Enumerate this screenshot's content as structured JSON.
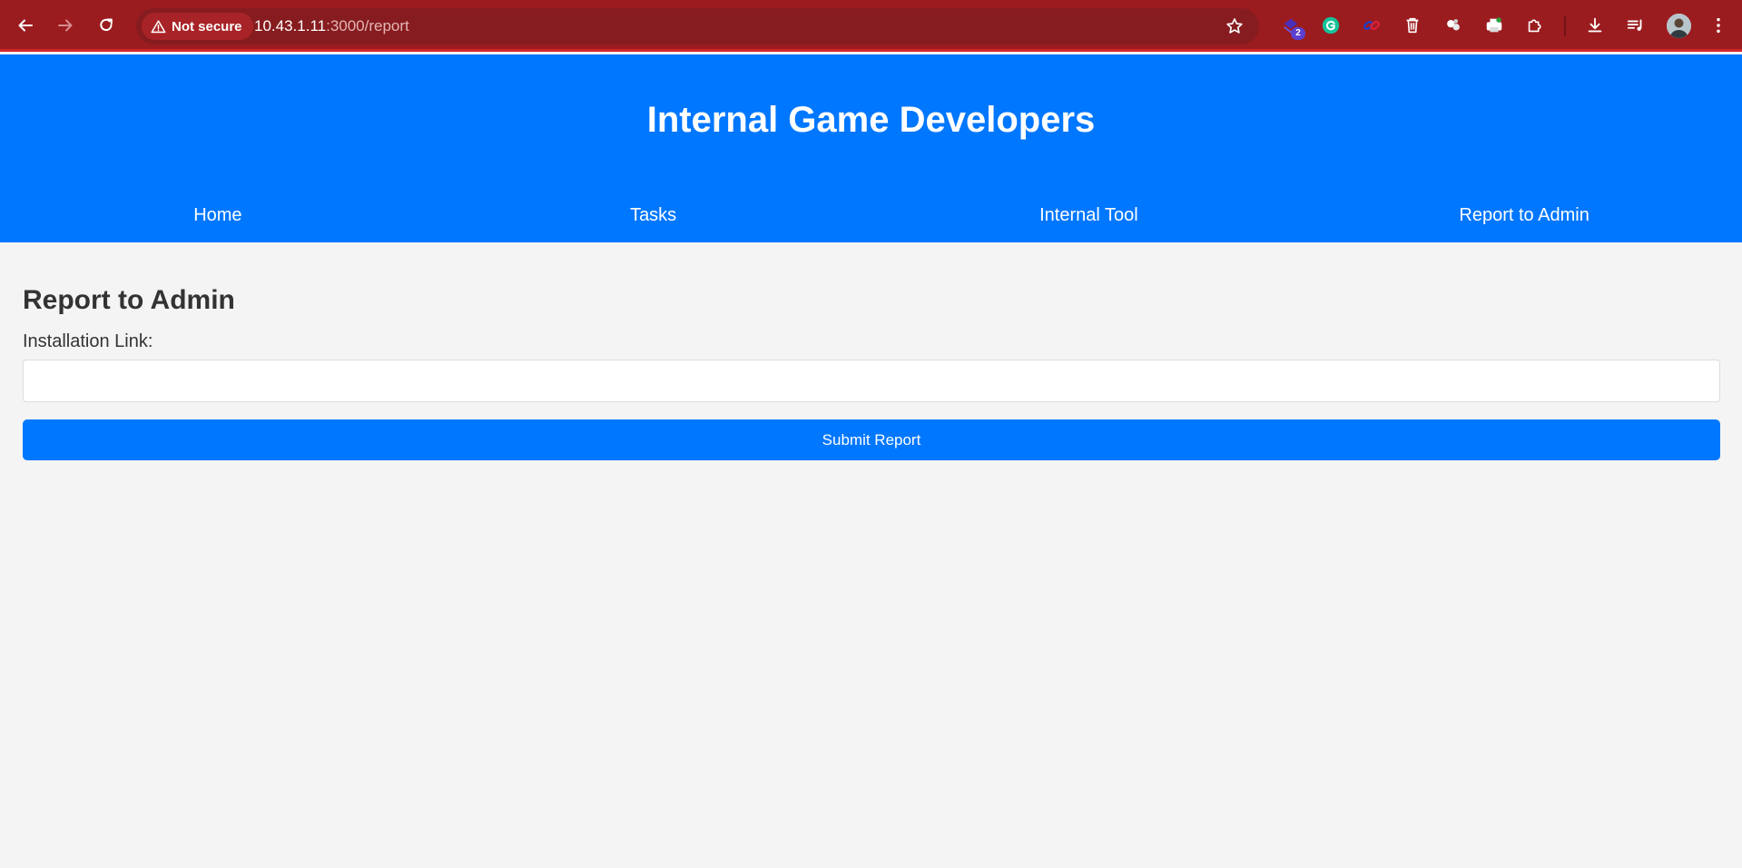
{
  "browser": {
    "security_label": "Not secure",
    "url_host": "10.43.1.11",
    "url_path": ":3000/report",
    "extension_badge": "2",
    "colors": {
      "toolbar": "#9b1c1f",
      "omnibox": "#861c1f"
    }
  },
  "header": {
    "title": "Internal Game Developers",
    "nav": [
      {
        "label": "Home"
      },
      {
        "label": "Tasks"
      },
      {
        "label": "Internal Tool"
      },
      {
        "label": "Report to Admin"
      }
    ],
    "color": "#0077ff"
  },
  "report": {
    "heading": "Report to Admin",
    "field_label": "Installation Link:",
    "field_value": "",
    "submit_label": "Submit Report"
  }
}
